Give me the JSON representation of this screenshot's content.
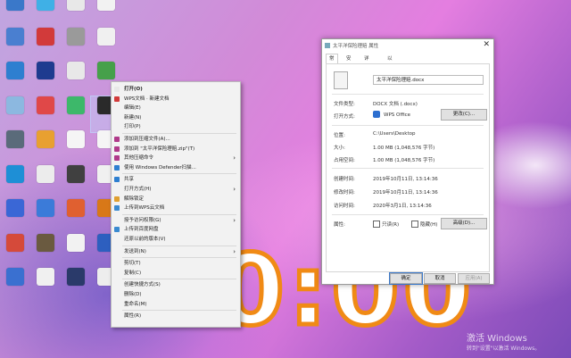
{
  "desktop": {
    "icons": [
      {
        "label": "",
        "color": "#3a78c9"
      },
      {
        "label": "",
        "color": "#3fb0e6"
      },
      {
        "label": "",
        "color": "#e8e8e8"
      },
      {
        "label": "",
        "color": "#f2f2f2"
      },
      {
        "label": "",
        "color": "#4a7fd0"
      },
      {
        "label": "",
        "color": "#d23a3a"
      },
      {
        "label": "",
        "color": "#9a9a9a"
      },
      {
        "label": "",
        "color": "#f0f0f0"
      },
      {
        "label": "",
        "color": "#2e7fd0"
      },
      {
        "label": "",
        "color": "#1e3b8f"
      },
      {
        "label": "",
        "color": "#e8e8e8"
      },
      {
        "label": "",
        "color": "#46a04a"
      },
      {
        "label": "",
        "color": "#8cb8e0"
      },
      {
        "label": "",
        "color": "#e04848"
      },
      {
        "label": "",
        "color": "#3db86a"
      },
      {
        "label": "",
        "color": "#2a2a2a"
      },
      {
        "label": "",
        "color": "#5a6b7a"
      },
      {
        "label": "",
        "color": "#e8a030"
      },
      {
        "label": "",
        "color": "#f5f5f5"
      },
      {
        "label": "",
        "color": "#f5f5f5"
      },
      {
        "label": "",
        "color": "#1e8fd6"
      },
      {
        "label": "",
        "color": "#ececec"
      },
      {
        "label": "",
        "color": "#404040"
      },
      {
        "label": "",
        "color": "#f0f0f0"
      },
      {
        "label": "",
        "color": "#3a67d6"
      },
      {
        "label": "",
        "color": "#3b7bd9"
      },
      {
        "label": "",
        "color": "#e06030"
      },
      {
        "label": "",
        "color": "#d87818"
      },
      {
        "label": "",
        "color": "#d54a3a"
      },
      {
        "label": "",
        "color": "#6a5a40"
      },
      {
        "label": "",
        "color": "#f2f2f2"
      },
      {
        "label": "",
        "color": "#2d5fbf"
      },
      {
        "label": "",
        "color": "#3a70d0"
      },
      {
        "label": "",
        "color": "#f0f0f0"
      },
      {
        "label": "",
        "color": "#2a3a6a"
      },
      {
        "label": "",
        "color": "#ededed"
      }
    ]
  },
  "clock": {
    "text": "00:00"
  },
  "watermark": {
    "line1": "激活 Windows",
    "line2": "转到\"设置\"以激活 Windows。"
  },
  "context_menu": {
    "items": [
      {
        "label": "打开(O)",
        "bold": true,
        "icon": "#e8e8e8",
        "sub": false
      },
      {
        "label": "WPS文档 · 新建文档",
        "icon": "#d23a3a",
        "sub": false
      },
      {
        "label": "编辑(E)",
        "icon": "",
        "sub": false
      },
      {
        "label": "新建(N)",
        "icon": "",
        "sub": false
      },
      {
        "label": "打印(P)",
        "icon": "",
        "sub": false
      },
      {
        "label": "添加到压缩文件(A)...",
        "icon": "#b03a8a",
        "sub": false
      },
      {
        "label": "添加到 \"太平洋保险理赔.zip\"(T)",
        "icon": "#b03a8a",
        "sub": false
      },
      {
        "label": "其他压缩命令",
        "icon": "#b03a8a",
        "sub": true
      },
      {
        "label": "使用 Windows Defender扫描...",
        "icon": "#2e7fd0",
        "sub": false
      },
      {
        "label": "共享",
        "icon": "#2e7fd0",
        "sub": false
      },
      {
        "label": "打开方式(H)",
        "icon": "",
        "sub": true
      },
      {
        "label": "解除锁定",
        "icon": "#e0a030",
        "sub": false
      },
      {
        "label": "上传到WPS云文档",
        "icon": "#3a8ad0",
        "sub": false
      },
      {
        "label": "授予访问权限(G)",
        "icon": "",
        "sub": true
      },
      {
        "label": "上传到百度网盘",
        "icon": "#3a8ad0",
        "sub": false
      },
      {
        "label": "还原以前的版本(V)",
        "icon": "",
        "sub": false
      },
      {
        "label": "发送到(N)",
        "icon": "",
        "sub": true
      },
      {
        "label": "剪切(T)",
        "icon": "",
        "sub": false
      },
      {
        "label": "复制(C)",
        "icon": "",
        "sub": false
      },
      {
        "label": "创建快捷方式(S)",
        "icon": "",
        "sub": false
      },
      {
        "label": "删除(D)",
        "icon": "",
        "sub": false
      },
      {
        "label": "重命名(M)",
        "icon": "",
        "sub": false
      },
      {
        "label": "属性(R)",
        "icon": "",
        "sub": false
      }
    ]
  },
  "properties": {
    "title": "太平洋保险理赔 属性",
    "tabs": [
      "常规",
      "安全",
      "详细信息",
      "以前的版本"
    ],
    "filename": "太平洋保险理赔.docx",
    "type_label": "文件类型:",
    "type_value": "DOCX 文档 (.docx)",
    "opens_label": "打开方式:",
    "opens_value": "WPS Office",
    "change_button": "更改(C)...",
    "location_label": "位置:",
    "location_value": "C:\\Users\\Desktop",
    "size_label": "大小:",
    "size_value": "1.00 MB (1,048,576 字节)",
    "disk_label": "占用空间:",
    "disk_value": "1.00 MB (1,048,576 字节)",
    "created_label": "创建时间:",
    "created_value": "2019年10月11日, 13:14:36",
    "modified_label": "修改时间:",
    "modified_value": "2019年10月11日, 13:14:36",
    "accessed_label": "访问时间:",
    "accessed_value": "2020年3月1日, 13:14:36",
    "attr_label": "属性:",
    "readonly_label": "只读(R)",
    "hidden_label": "隐藏(H)",
    "advanced_button": "高级(D)...",
    "ok_button": "确定",
    "cancel_button": "取消",
    "apply_button": "应用(A)"
  }
}
